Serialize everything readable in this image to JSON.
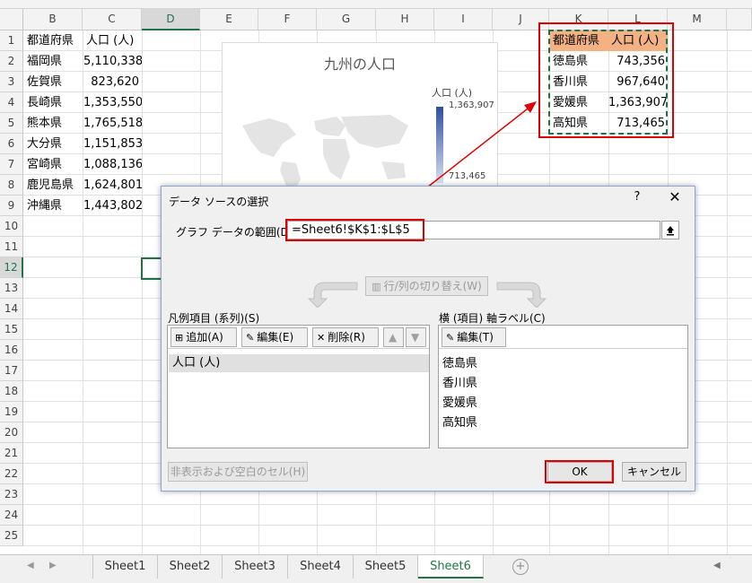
{
  "columns": [
    "B",
    "C",
    "D",
    "E",
    "F",
    "G",
    "H",
    "I",
    "J",
    "K",
    "L",
    "M"
  ],
  "selected_column": "D",
  "rows": [
    "1",
    "2",
    "3",
    "4",
    "5",
    "6",
    "7",
    "8",
    "9",
    "10",
    "11",
    "12",
    "13",
    "14",
    "15",
    "16",
    "17",
    "18",
    "19",
    "20",
    "21",
    "22",
    "23",
    "24",
    "25"
  ],
  "selected_row": "12",
  "table_left": {
    "header": [
      "都道府県",
      "人口 (人)"
    ],
    "rows": [
      [
        "福岡県",
        "5,110,338"
      ],
      [
        "佐賀県",
        "823,620"
      ],
      [
        "長崎県",
        "1,353,550"
      ],
      [
        "熊本県",
        "1,765,518"
      ],
      [
        "大分県",
        "1,151,853"
      ],
      [
        "宮崎県",
        "1,088,136"
      ],
      [
        "鹿児島県",
        "1,624,801"
      ],
      [
        "沖縄県",
        "1,443,802"
      ]
    ]
  },
  "table_right": {
    "header": [
      "都道府県",
      "人口 (人)"
    ],
    "rows": [
      [
        "徳島県",
        "743,356"
      ],
      [
        "香川県",
        "967,640"
      ],
      [
        "愛媛県",
        "1,363,907"
      ],
      [
        "高知県",
        "713,465"
      ]
    ]
  },
  "chart": {
    "title": "九州の人口",
    "legend_title": "人口 (人)",
    "legend_max": "1,363,907",
    "legend_min": "713,465",
    "gradient_colors": [
      "#2f4f9f",
      "#d7def0"
    ]
  },
  "dialog": {
    "title": "データ ソースの選択",
    "help": "?",
    "close": "✕",
    "range_label": "グラフ データの範囲(D):",
    "range_value": "=Sheet6!$K$1:$L$5",
    "switch_button": "行/列の切り替え(W)",
    "series_label": "凡例項目 (系列)(S)",
    "series_buttons": {
      "add": "追加(A)",
      "edit": "編集(E)",
      "delete": "削除(R)"
    },
    "series_items": [
      "人口 (人)"
    ],
    "axis_label": "横 (項目) 軸ラベル(C)",
    "axis_edit": "編集(T)",
    "axis_items": [
      "徳島県",
      "香川県",
      "愛媛県",
      "高知県"
    ],
    "hidden_button": "非表示および空白のセル(H)",
    "ok": "OK",
    "cancel": "キャンセル"
  },
  "sheet_tabs": [
    "Sheet1",
    "Sheet2",
    "Sheet3",
    "Sheet4",
    "Sheet5",
    "Sheet6"
  ],
  "active_tab": "Sheet6",
  "colors": {
    "excel_green": "#217346",
    "highlight_orange": "#f4b183",
    "annotation_red": "#e00000"
  }
}
